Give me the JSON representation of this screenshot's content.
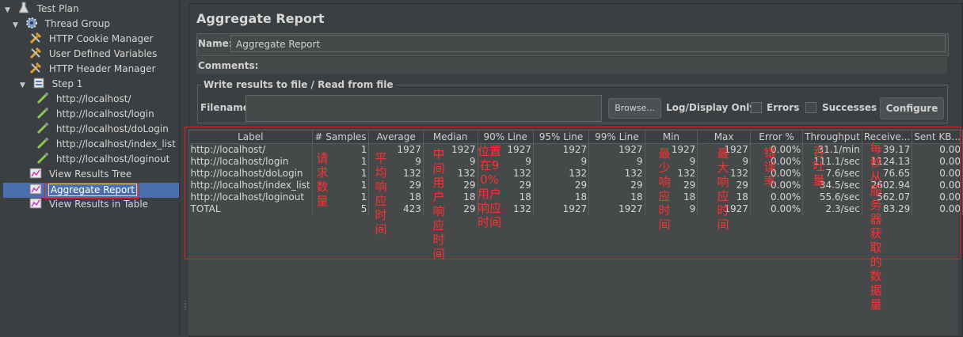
{
  "tree": {
    "items": [
      {
        "label": "Test Plan",
        "icon": "flask-icon",
        "toggle": "▼"
      },
      {
        "label": "Thread Group",
        "icon": "gear-icon",
        "toggle": "▼"
      },
      {
        "label": "HTTP Cookie Manager",
        "icon": "wrench-icon"
      },
      {
        "label": "User Defined Variables",
        "icon": "wrench-icon"
      },
      {
        "label": "HTTP Header Manager",
        "icon": "wrench-icon"
      },
      {
        "label": "Step 1",
        "icon": "controller-icon",
        "toggle": "▼"
      },
      {
        "label": "http://localhost/",
        "icon": "pipette-icon"
      },
      {
        "label": "http://localhost/login",
        "icon": "pipette-icon"
      },
      {
        "label": "http://localhost/doLogin",
        "icon": "pipette-icon"
      },
      {
        "label": "http://localhost/index_list",
        "icon": "pipette-icon"
      },
      {
        "label": "http://localhost/loginout",
        "icon": "pipette-icon"
      },
      {
        "label": "View Results Tree",
        "icon": "chart-icon"
      },
      {
        "label": "Aggregate Report",
        "icon": "chart-icon",
        "selected": true
      },
      {
        "label": "View Results in Table",
        "icon": "chart-icon"
      }
    ]
  },
  "panel": {
    "title": "Aggregate Report",
    "name_label": "Name:",
    "name_value": "Aggregate Report",
    "comments_label": "Comments:",
    "file_section_title": "Write results to file / Read from file",
    "filename_label": "Filename",
    "browse_label": "Browse...",
    "log_display_label": "Log/Display Only:",
    "errors_label": "Errors",
    "successes_label": "Successes",
    "configure_label": "Configure"
  },
  "table": {
    "headers": [
      "Label",
      "# Samples",
      "Average",
      "Median",
      "90% Line",
      "95% Line",
      "99% Line",
      "Min",
      "Max",
      "Error %",
      "Throughput",
      "Receive...",
      "Sent KB..."
    ],
    "rows": [
      [
        "http://localhost/",
        "1",
        "1927",
        "1927",
        "1927",
        "1927",
        "1927",
        "1927",
        "1927",
        "0.00%",
        "31.1/min",
        "39.17",
        "0.00"
      ],
      [
        "http://localhost/login",
        "1",
        "9",
        "9",
        "9",
        "9",
        "9",
        "9",
        "9",
        "0.00%",
        "111.1/sec",
        "1124.13",
        "0.00"
      ],
      [
        "http://localhost/doLogin",
        "1",
        "132",
        "132",
        "132",
        "132",
        "132",
        "132",
        "132",
        "0.00%",
        "7.6/sec",
        "76.65",
        "0.00"
      ],
      [
        "http://localhost/index_list",
        "1",
        "29",
        "29",
        "29",
        "29",
        "29",
        "29",
        "29",
        "0.00%",
        "34.5/sec",
        "2602.94",
        "0.00"
      ],
      [
        "http://localhost/loginout",
        "1",
        "18",
        "18",
        "18",
        "18",
        "18",
        "18",
        "18",
        "0.00%",
        "55.6/sec",
        "562.07",
        "0.00"
      ],
      [
        "TOTAL",
        "5",
        "423",
        "29",
        "132",
        "1927",
        "1927",
        "9",
        "1927",
        "0.00%",
        "2.3/sec",
        "83.29",
        "0.00"
      ]
    ]
  },
  "annotations": {
    "samples": "请求数量",
    "average": "平均响应时间",
    "median": "中间用户响应时间",
    "line90": "位置在90%用户响应时间",
    "min": "最少响应时间",
    "max": "最大响应时间",
    "error": "错误率",
    "throughput": "吞吐量",
    "received": "每秒从服务器获取的数据量"
  },
  "colors": {
    "background": "#3c3f41",
    "selection": "#4b6eaf",
    "annotation": "#ff3030"
  }
}
